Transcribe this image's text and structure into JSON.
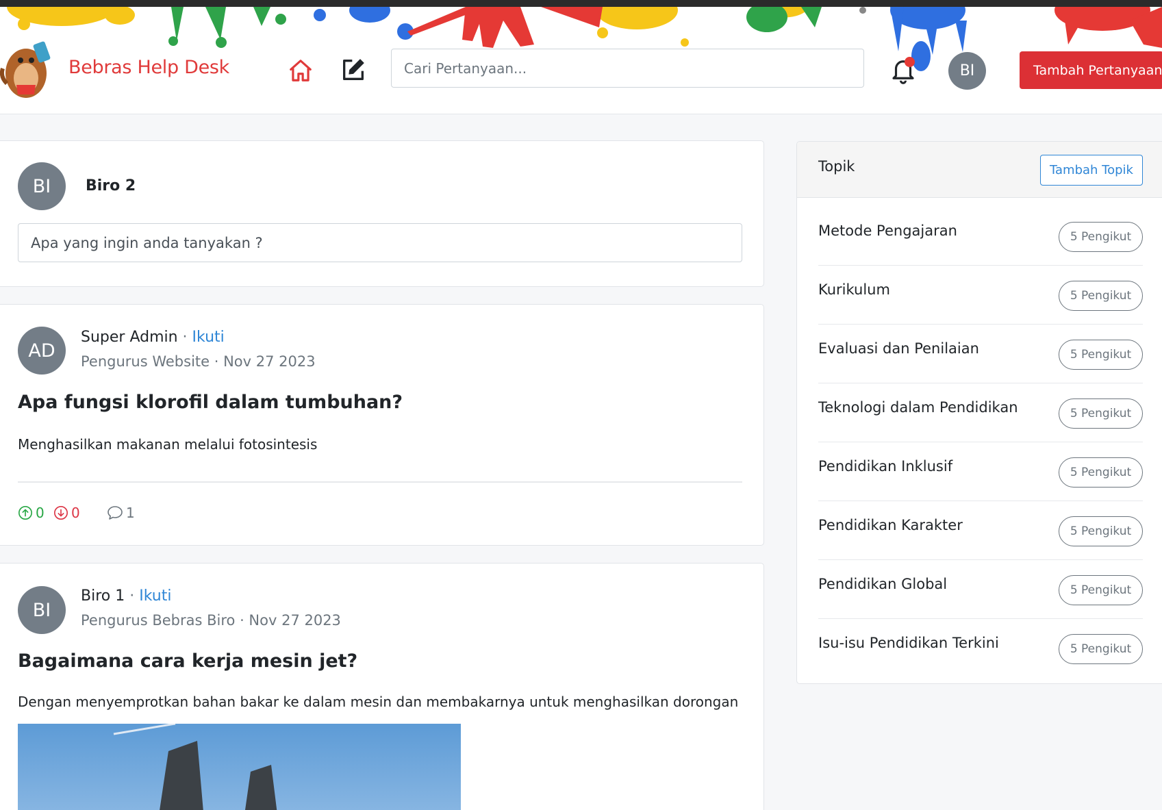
{
  "header": {
    "brand": "Bebras Help Desk",
    "search_placeholder": "Cari Pertanyaan...",
    "user_initials": "BI",
    "add_question_label": "Tambah Pertanyaan"
  },
  "composer": {
    "initials": "BI",
    "user_name": "Biro 2",
    "placeholder": "Apa yang ingin anda tanyakan ?"
  },
  "posts": [
    {
      "initials": "AD",
      "author": "Super Admin",
      "separator": " · ",
      "follow_label": "Ikuti",
      "role": "Pengurus Website",
      "date": "Nov 27 2023",
      "date_sep": " · ",
      "title": "Apa fungsi klorofil dalam tumbuhan?",
      "answer": "Menghasilkan makanan melalui fotosintesis",
      "upvotes": "0",
      "downvotes": "0",
      "comments": "1"
    },
    {
      "initials": "BI",
      "author": "Biro 1",
      "separator": " · ",
      "follow_label": "Ikuti",
      "role": "Pengurus Bebras Biro",
      "date": "Nov 27 2023",
      "date_sep": " · ",
      "title": "Bagaimana cara kerja mesin jet?",
      "answer": "Dengan menyemprotkan bahan bakar ke dalam mesin dan membakarnya untuk menghasilkan dorongan"
    }
  ],
  "sidebar": {
    "title": "Topik",
    "add_topic_label": "Tambah Topik",
    "topics": [
      {
        "name": "Metode Pengajaran",
        "followers": "5 Pengikut"
      },
      {
        "name": "Kurikulum",
        "followers": "5 Pengikut"
      },
      {
        "name": "Evaluasi dan Penilaian",
        "followers": "5 Pengikut"
      },
      {
        "name": "Teknologi dalam Pendidikan",
        "followers": "5 Pengikut"
      },
      {
        "name": "Pendidikan Inklusif",
        "followers": "5 Pengikut"
      },
      {
        "name": "Pendidikan Karakter",
        "followers": "5 Pengikut"
      },
      {
        "name": "Pendidikan Global",
        "followers": "5 Pengikut"
      },
      {
        "name": "Isu-isu Pendidikan Terkini",
        "followers": "5 Pengikut"
      }
    ]
  },
  "colors": {
    "brand": "#e03a3a",
    "primary_button": "#dc3035",
    "link": "#2f86d6",
    "upvote": "#28a745",
    "downvote": "#dc3545",
    "avatar": "#737d87"
  },
  "icons": [
    "home-icon",
    "edit-icon",
    "bell-icon",
    "arrow-up-circle-icon",
    "arrow-down-circle-icon",
    "comment-icon"
  ]
}
